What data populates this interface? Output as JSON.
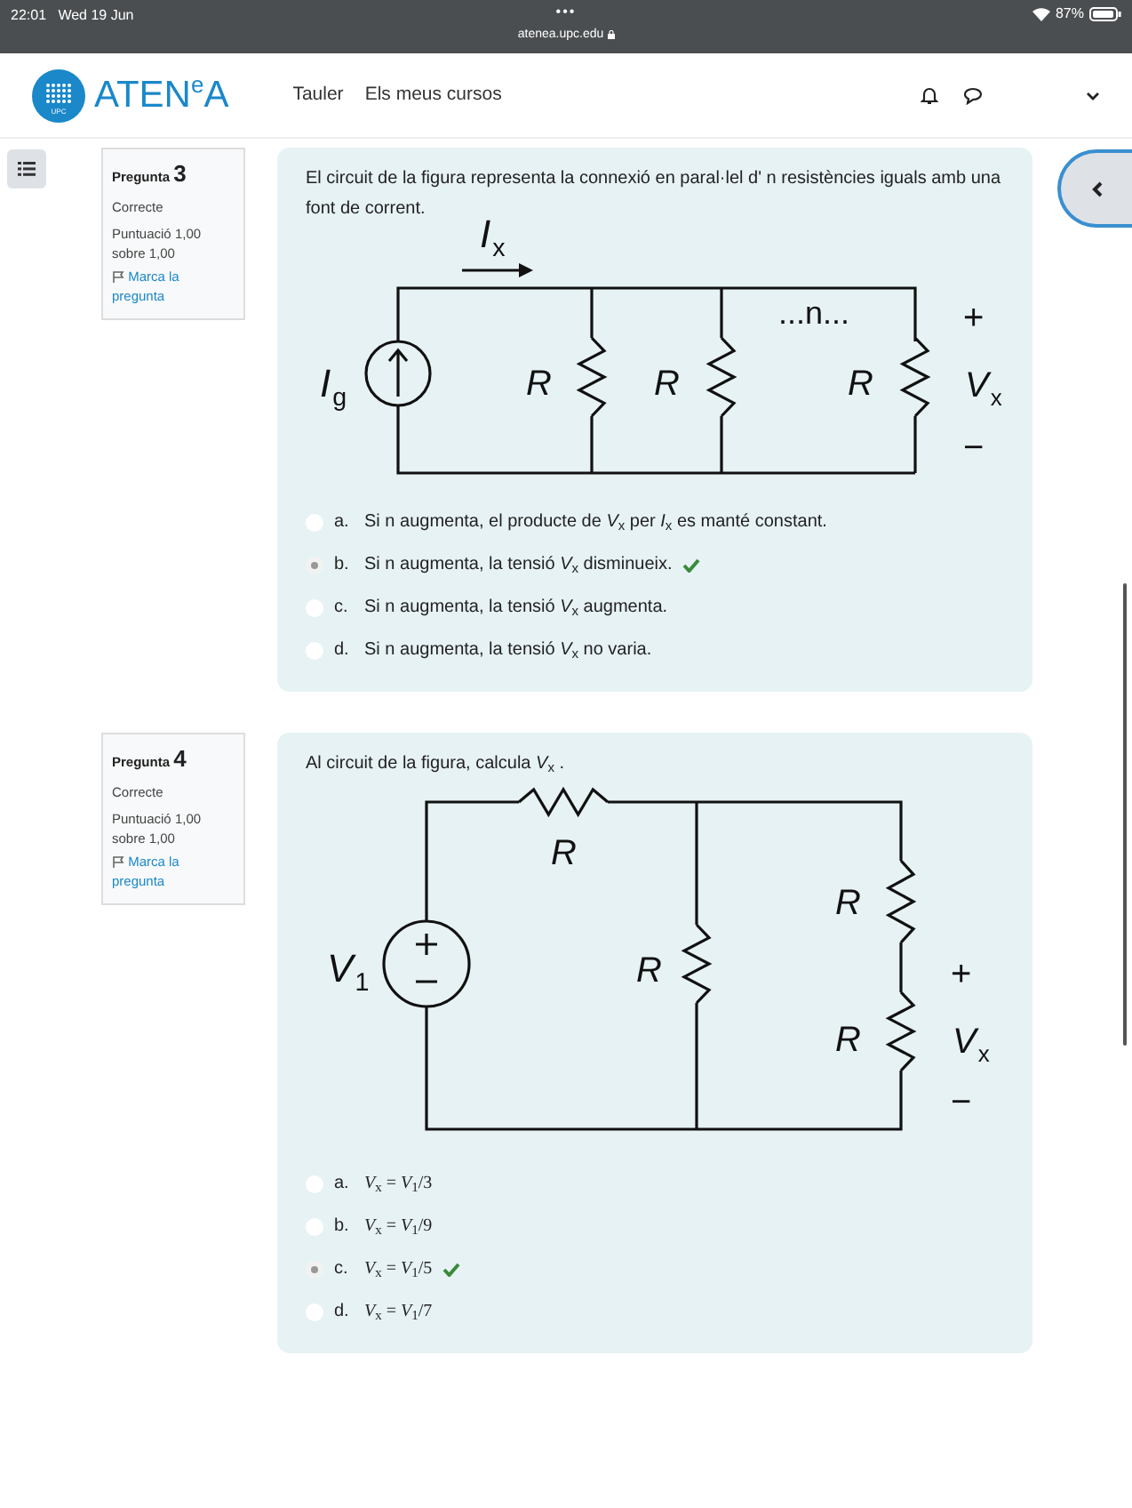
{
  "status_bar": {
    "time": "22:01",
    "date": "Wed 19 Jun",
    "dots": "•••",
    "url": "atenea.upc.edu",
    "battery": "87%"
  },
  "header": {
    "logo_mark": "UPC",
    "logo_text": "ATEN$^{e}$A",
    "nav": [
      "Tauler",
      "Els meus cursos"
    ]
  },
  "questions": [
    {
      "label": "Pregunta",
      "number": "3",
      "state": "Correcte",
      "grade": "Puntuació 1,00 sobre 1,00",
      "flag": "Marca la pregunta",
      "text": "El circuit de la figura representa la connexió en paral·lel d' n resistències iguals amb una font de corrent.",
      "figure": {
        "kind": "parallel",
        "labels": [
          {
            "text": "I",
            "sub": "x"
          },
          {
            "text": "I",
            "sub": "g"
          },
          {
            "text": "R"
          },
          {
            "text": "R"
          },
          {
            "text": "...n..."
          },
          {
            "text": "R"
          },
          {
            "text": "+"
          },
          {
            "text": "V",
            "sub": "x"
          },
          {
            "text": "−"
          }
        ]
      },
      "options": [
        {
          "letter": "a.",
          "text": "Si n augmenta, el producte de *V*$_{x}$ per *I*$_{x}$ es manté constant.",
          "selected": false,
          "correct": false
        },
        {
          "letter": "b.",
          "text": "Si n augmenta, la tensió *V*$_{x}$ disminueix.",
          "selected": true,
          "correct": true
        },
        {
          "letter": "c.",
          "text": "Si n augmenta, la tensió *V*$_{x}$ augmenta.",
          "selected": false,
          "correct": false
        },
        {
          "letter": "d.",
          "text": "Si n augmenta, la tensió *V*$_{x}$ no varia.",
          "selected": false,
          "correct": false
        }
      ]
    },
    {
      "label": "Pregunta",
      "number": "4",
      "state": "Correcte",
      "grade": "Puntuació 1,00 sobre 1,00",
      "flag": "Marca la pregunta",
      "text": "Al circuit de la figura, calcula *V*$_{x}$ .",
      "figure": {
        "kind": "ladder",
        "labels": [
          {
            "text": "V",
            "sub": "1"
          },
          {
            "text": "R"
          },
          {
            "text": "R"
          },
          {
            "text": "R"
          },
          {
            "text": "R"
          },
          {
            "text": "+"
          },
          {
            "text": "V",
            "sub": "x"
          },
          {
            "text": "−"
          }
        ]
      },
      "options": [
        {
          "letter": "a.",
          "text": "*V*$_{x}$ = *V*$_{1}$/3",
          "selected": false,
          "correct": false
        },
        {
          "letter": "b.",
          "text": "*V*$_{x}$ = *V*$_{1}$/9",
          "selected": false,
          "correct": false
        },
        {
          "letter": "c.",
          "text": "*V*$_{x}$ = *V*$_{1}$/5",
          "selected": true,
          "correct": true
        },
        {
          "letter": "d.",
          "text": "*V*$_{x}$ = *V*$_{1}$/7",
          "selected": false,
          "correct": false
        }
      ]
    }
  ]
}
